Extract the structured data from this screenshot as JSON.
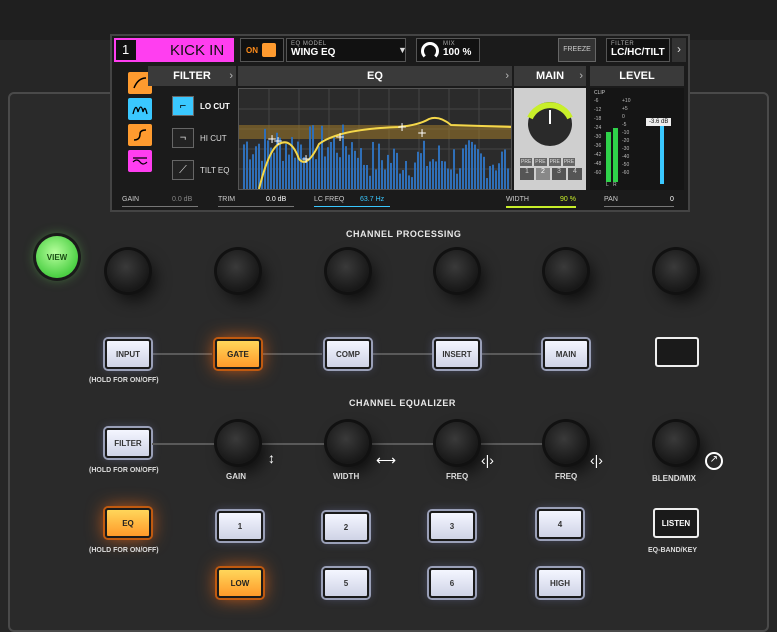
{
  "screen": {
    "channel_number": "1",
    "channel_name": "KICK IN",
    "on_label": "ON",
    "eq_model_caption": "EQ MODEL",
    "eq_model_value": "WING EQ",
    "mix_caption": "MIX",
    "mix_value": "100 %",
    "freeze_label": "FREEZE",
    "filter_caption": "FILTER",
    "filter_value": "LC/HC/TILT",
    "sections": {
      "filter": "FILTER",
      "eq": "EQ",
      "main": "MAIN",
      "level": "LEVEL"
    },
    "filter_items": [
      "LO CUT",
      "HI CUT",
      "TILT EQ"
    ],
    "main_pre": [
      "PRE",
      "PRE",
      "PRE",
      "PRE"
    ],
    "main_buses": [
      "1",
      "2",
      "3",
      "4"
    ],
    "level_value": "-3.6 dB",
    "meter_clip": "CLIP",
    "meter_left_scale": [
      "-6",
      "-12",
      "-18",
      "-24",
      "-30",
      "-36",
      "-42",
      "-48",
      "-60"
    ],
    "meter_right_scale": [
      "+10",
      "+5",
      "0",
      "-5",
      "-10",
      "-20",
      "-30",
      "-40",
      "-50",
      "-60"
    ],
    "meter_lr": [
      "L",
      "R"
    ],
    "bottom": {
      "gain_label": "GAIN",
      "gain_value": "0.0 dB",
      "trim_label": "TRIM",
      "trim_value": "0.0 dB",
      "lcfreq_label": "LC FREQ",
      "lcfreq_value": "63.7 Hz",
      "width_label": "WIDTH",
      "width_value": "90 %",
      "pan_label": "PAN",
      "pan_value": "0"
    },
    "colors": {
      "channel": "#ff3ef0",
      "accent_orange": "#ff9b2f",
      "accent_cyan": "#3ac8ff",
      "eq_curve": "#f5d84a",
      "meter_green": "#2fd24a"
    }
  },
  "console": {
    "view_label": "VIEW",
    "channel_processing_title": "CHANNEL PROCESSING",
    "processing_buttons": [
      "INPUT",
      "GATE",
      "COMP",
      "INSERT",
      "MAIN"
    ],
    "hold_label": "(HOLD FOR ON/OFF)",
    "channel_equalizer_title": "CHANNEL EQUALIZER",
    "filter_button": "FILTER",
    "eq_knob_labels": [
      "GAIN",
      "WIDTH",
      "FREQ",
      "FREQ",
      "BLEND/MIX"
    ],
    "eq_button": "EQ",
    "band_buttons_top": [
      "1",
      "2",
      "3",
      "4"
    ],
    "band_buttons_bottom": [
      "LOW",
      "5",
      "6",
      "HIGH"
    ],
    "listen_button": "LISTEN",
    "listen_sub": "EQ-BAND/KEY"
  }
}
